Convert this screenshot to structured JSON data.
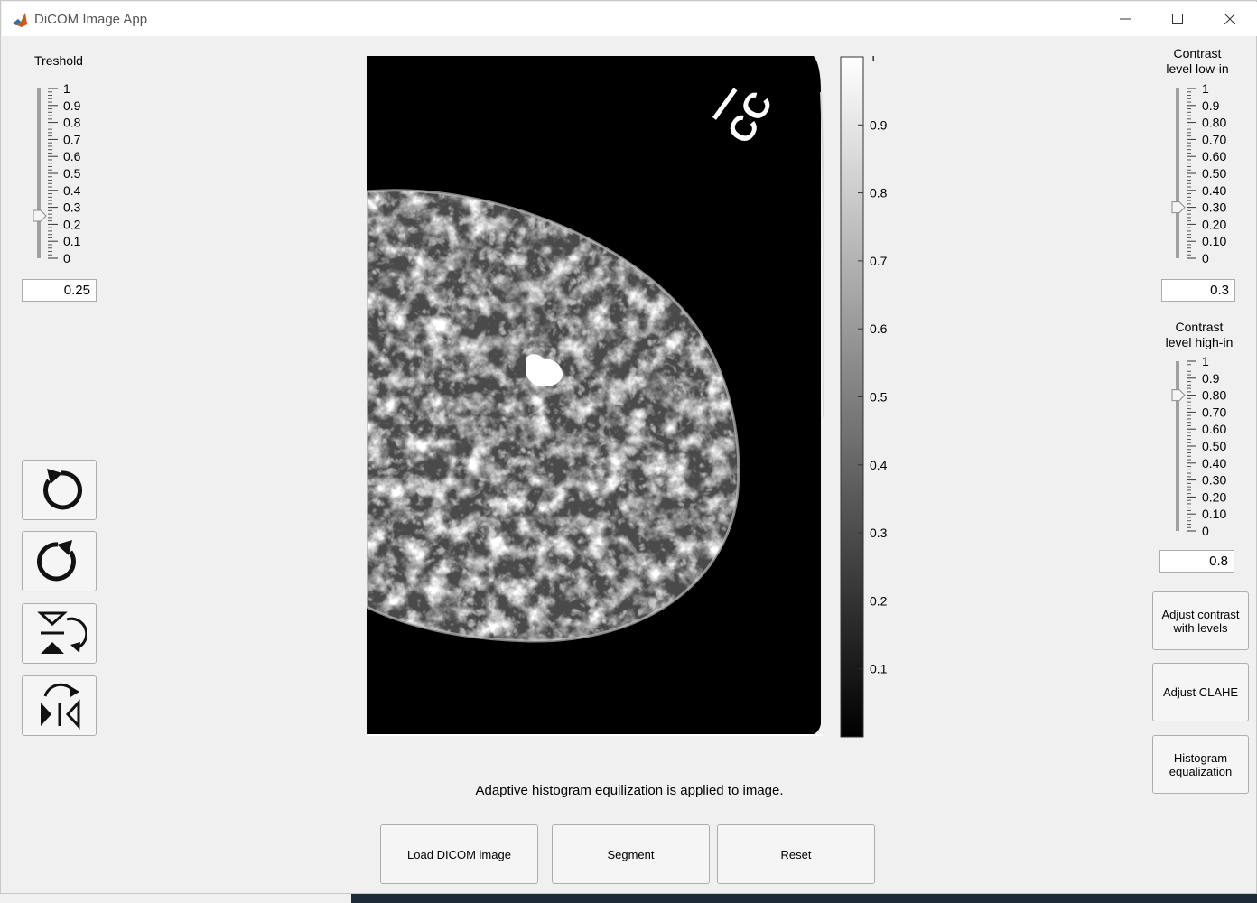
{
  "window": {
    "title": "DiCOM Image App",
    "controls": [
      "minimize",
      "maximize",
      "close"
    ]
  },
  "threshold": {
    "label": "Treshold",
    "value": "0.25",
    "level": 0.25,
    "ticks": [
      "1",
      "0.9",
      "0.8",
      "0.7",
      "0.6",
      "0.5",
      "0.4",
      "0.3",
      "0.2",
      "0.1",
      "0"
    ]
  },
  "contrast_low": {
    "label_line1": "Contrast",
    "label_line2": "level low-in",
    "value": "0.3",
    "level": 0.3,
    "ticks": [
      "1",
      "0.9",
      "0.80",
      "0.70",
      "0.60",
      "0.50",
      "0.40",
      "0.30",
      "0.20",
      "0.10",
      "0"
    ]
  },
  "contrast_high": {
    "label_line1": "Contrast",
    "label_line2": "level high-in",
    "value": "0.8",
    "level": 0.8,
    "ticks": [
      "1",
      "0.9",
      "0.80",
      "0.70",
      "0.60",
      "0.50",
      "0.40",
      "0.30",
      "0.20",
      "0.10",
      "0"
    ]
  },
  "tool_buttons": [
    "rotate-counterclockwise-icon",
    "rotate-clockwise-icon",
    "flip-vertical-icon",
    "flip-horizontal-icon"
  ],
  "colorbar": {
    "ticks": [
      "1",
      "0.9",
      "0.8",
      "0.7",
      "0.6",
      "0.5",
      "0.4",
      "0.3",
      "0.2",
      "0.1"
    ]
  },
  "image": {
    "marker_text": "CC"
  },
  "status_text": "Adaptive histogram equilization is applied to image.",
  "right_buttons": {
    "levels_line1": "Adjust contrast",
    "levels_line2": "with levels",
    "clahe": "Adjust CLAHE",
    "hist_line1": "Histogram",
    "hist_line2": "equalization"
  },
  "bottom_buttons": {
    "load": "Load DICOM image",
    "segment": "Segment",
    "reset": "Reset"
  },
  "colors": {
    "background": "#f0f0f0",
    "image_background": "#000000",
    "segment_highlight": "#ffffff"
  }
}
